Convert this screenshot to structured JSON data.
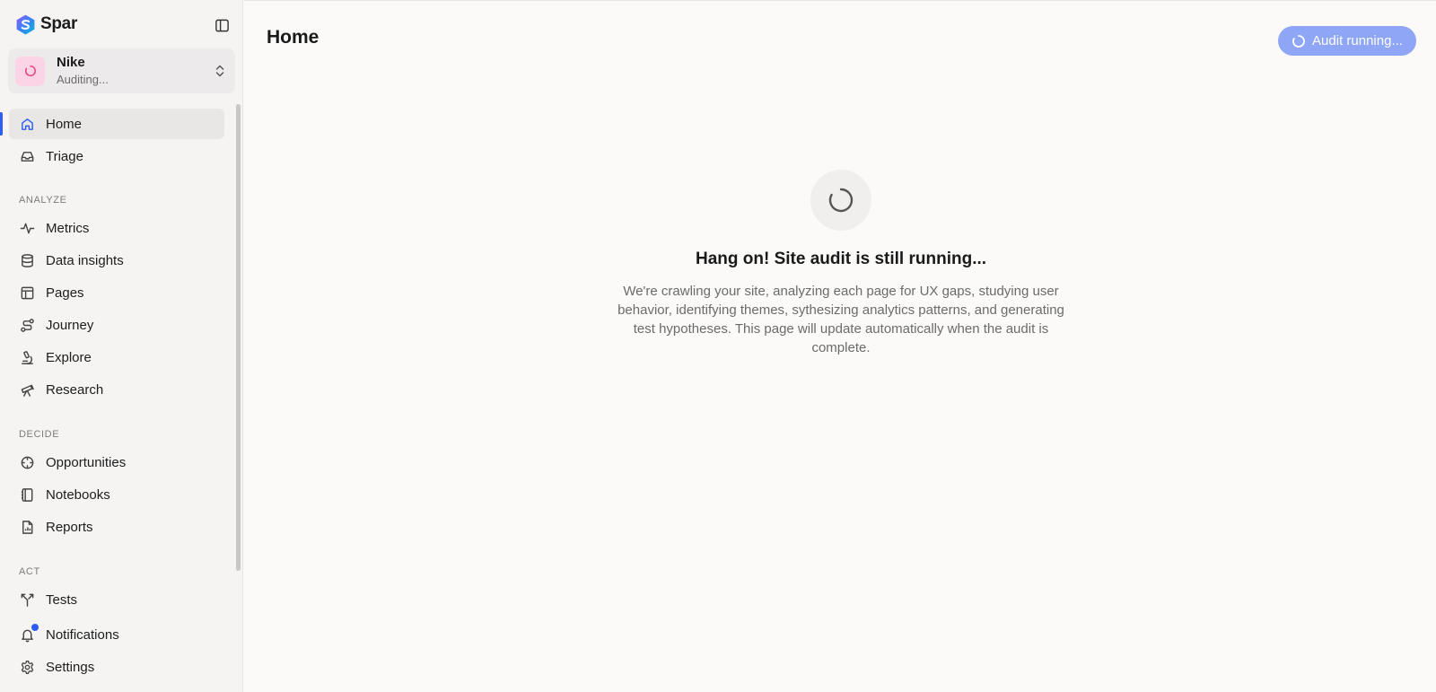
{
  "brand": {
    "name": "Spar",
    "logo_icon": "spar-logo-icon"
  },
  "sidebar": {
    "toggle_icon": "sidebar-toggle-icon",
    "workspace": {
      "name": "Nike",
      "status": "Auditing..."
    },
    "items": [
      {
        "label": "Home",
        "icon": "home-icon",
        "active": true
      },
      {
        "label": "Triage",
        "icon": "inbox-icon"
      }
    ],
    "sections": [
      {
        "label": "ANALYZE",
        "items": [
          {
            "label": "Metrics",
            "icon": "activity-icon"
          },
          {
            "label": "Data insights",
            "icon": "database-icon"
          },
          {
            "label": "Pages",
            "icon": "layout-icon"
          },
          {
            "label": "Journey",
            "icon": "route-icon"
          },
          {
            "label": "Explore",
            "icon": "microscope-icon"
          },
          {
            "label": "Research",
            "icon": "telescope-icon"
          }
        ]
      },
      {
        "label": "DECIDE",
        "items": [
          {
            "label": "Opportunities",
            "icon": "crosshair-icon"
          },
          {
            "label": "Notebooks",
            "icon": "notebook-icon"
          },
          {
            "label": "Reports",
            "icon": "report-icon"
          }
        ]
      },
      {
        "label": "ACT",
        "items": [
          {
            "label": "Tests",
            "icon": "split-icon"
          },
          {
            "label": "Notifications",
            "icon": "bell-icon",
            "has_badge": true
          },
          {
            "label": "Settings",
            "icon": "gear-icon"
          }
        ]
      }
    ]
  },
  "header": {
    "title": "Home",
    "audit_button": "Audit running..."
  },
  "empty_state": {
    "title": "Hang on! Site audit is still running...",
    "description": "We're crawling your site, analyzing each page for UX gaps, studying user behavior, identifying themes, sythesizing analytics patterns, and generating test hypotheses. This page will update automatically when the audit is complete."
  },
  "colors": {
    "accent": "#2e5cf6",
    "button_disabled": "#8fa6f6",
    "workspace_avatar": "#fbd5e6"
  }
}
